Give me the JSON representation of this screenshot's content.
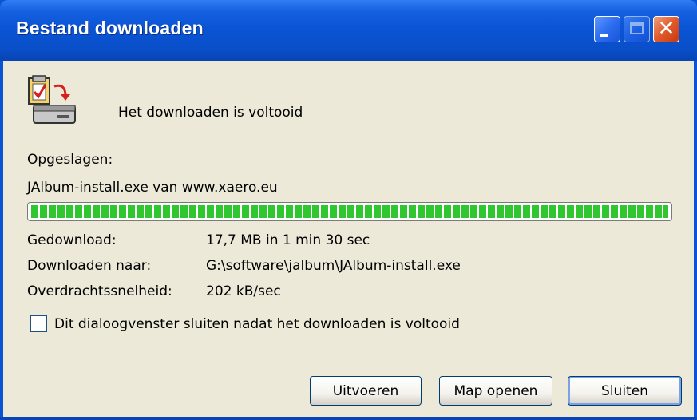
{
  "window": {
    "title": "Bestand downloaden",
    "controls": [
      "minimize",
      "maximize",
      "close"
    ]
  },
  "status": {
    "message": "Het downloaden is voltooid",
    "icon": "download-complete-icon"
  },
  "saved": {
    "label": "Opgeslagen:",
    "description": "JAlbum-install.exe van www.xaero.eu"
  },
  "progress": {
    "fraction": 1.0,
    "color": "#2fc62f"
  },
  "details": [
    {
      "label": "Gedownload:",
      "value": "17,7 MB in 1 min 30 sec"
    },
    {
      "label": "Downloaden naar:",
      "value": "G:\\software\\jalbum\\JAlbum-install.exe"
    },
    {
      "label": "Overdrachtssnelheid:",
      "value": "202 kB/sec"
    }
  ],
  "close_option": {
    "label": "Dit dialoogvenster sluiten nadat het downloaden is voltooid",
    "checked": false
  },
  "buttons": {
    "run": "Uitvoeren",
    "open_folder": "Map openen",
    "close": "Sluiten"
  },
  "colors": {
    "titlebar": "#0a54d6",
    "dialog_bg": "#ece9d8",
    "close_button": "#e05a2a"
  }
}
